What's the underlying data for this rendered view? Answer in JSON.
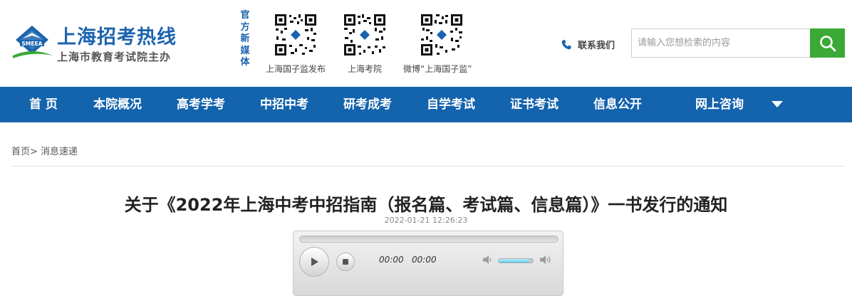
{
  "site": {
    "name": "上海招考热线",
    "subtitle": "上海市教育考试院主办",
    "logo_text": "SMEEA",
    "brand_color": "#1a63ae"
  },
  "media": {
    "label": "官方新媒体",
    "qrcodes": [
      {
        "caption": "上海国子监发布"
      },
      {
        "caption": "上海考院"
      },
      {
        "caption": "微博“上海国子监”"
      }
    ]
  },
  "contact": {
    "label": "联系我们",
    "icon": "phone-icon"
  },
  "search": {
    "placeholder": "请输入您想检索的内容",
    "button_icon": "search-icon",
    "button_color": "#3aa935"
  },
  "nav": {
    "color": "#1363ad",
    "items": [
      {
        "label": "首  页"
      },
      {
        "label": "本院概况"
      },
      {
        "label": "高考学考"
      },
      {
        "label": "中招中考"
      },
      {
        "label": "研考成考"
      },
      {
        "label": "自学考试"
      },
      {
        "label": "证书考试"
      },
      {
        "label": "信息公开"
      },
      {
        "label": "网上咨询"
      }
    ],
    "dropdown_icon": "caret-down-icon"
  },
  "breadcrumb": {
    "home": "首页",
    "separator": ">",
    "current": " 消息速递"
  },
  "article": {
    "title": "关于《2022年上海中考中招指南（报名篇、考试篇、信息篇）》一书发行的通知",
    "date": "2022-01-21 12:26:23"
  },
  "player": {
    "current_time": "00:00",
    "duration": "00:00",
    "progress": 0,
    "volume": 0.9
  }
}
